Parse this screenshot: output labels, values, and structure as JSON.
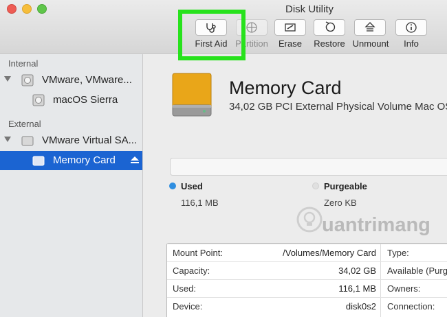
{
  "window": {
    "title": "Disk Utility"
  },
  "toolbar": {
    "buttons": [
      {
        "label": "First Aid",
        "icon": "stethoscope-icon"
      },
      {
        "label": "Partition",
        "icon": "partition-icon"
      },
      {
        "label": "Erase",
        "icon": "erase-icon"
      },
      {
        "label": "Restore",
        "icon": "restore-icon"
      },
      {
        "label": "Unmount",
        "icon": "unmount-icon"
      },
      {
        "label": "Info",
        "icon": "info-icon"
      }
    ],
    "highlight_color": "#27e21c"
  },
  "sidebar": {
    "sections": [
      {
        "label": "Internal"
      },
      {
        "label": "External"
      }
    ],
    "items": [
      {
        "label": "VMware, VMware..."
      },
      {
        "label": "macOS Sierra"
      },
      {
        "label": "VMware Virtual SA..."
      },
      {
        "label": "Memory Card"
      }
    ],
    "selected_color": "#1b64d2"
  },
  "main": {
    "disk_title": "Memory Card",
    "disk_subtitle": "34,02 GB PCI External Physical Volume Mac OS",
    "legend": {
      "used_label": "Used",
      "used_value": "116,1 MB",
      "used_color": "#2f8ee0",
      "purgeable_label": "Purgeable",
      "purgeable_value": "Zero KB"
    },
    "info": [
      {
        "key": "Mount Point:",
        "value": "/Volumes/Memory Card",
        "key2": "Type:"
      },
      {
        "key": "Capacity:",
        "value": "34,02 GB",
        "key2": "Available (Purge"
      },
      {
        "key": "Used:",
        "value": "116,1 MB",
        "key2": "Owners:"
      },
      {
        "key": "Device:",
        "value": "disk0s2",
        "key2": "Connection:"
      }
    ]
  },
  "watermark": {
    "text": "uantrimang"
  }
}
